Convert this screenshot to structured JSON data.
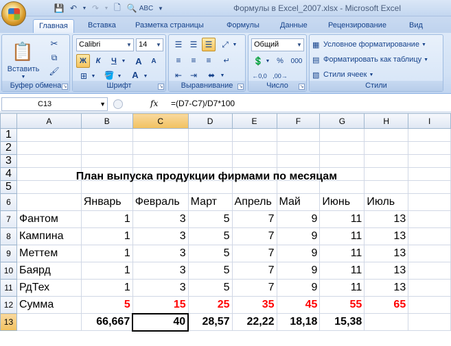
{
  "window": {
    "title": "Формулы в Excel_2007.xlsx - Microsoft Excel"
  },
  "tabs": [
    "Главная",
    "Вставка",
    "Разметка страницы",
    "Формулы",
    "Данные",
    "Рецензирование",
    "Вид"
  ],
  "ribbon": {
    "clipboard": {
      "label": "Буфер обмена",
      "paste": "Вставить"
    },
    "font": {
      "label": "Шрифт",
      "name": "Calibri",
      "size": "14",
      "bold": "Ж",
      "italic": "К",
      "underline": "Ч",
      "grow": "A",
      "shrink": "A"
    },
    "alignment": {
      "label": "Выравнивание"
    },
    "number": {
      "label": "Число",
      "format": "Общий",
      "percent": "%",
      "thousands": "000"
    },
    "styles": {
      "label": "Стили",
      "conditional": "Условное форматирование",
      "as_table": "Форматировать как таблицу",
      "cell_styles": "Стили ячеек"
    }
  },
  "formula_bar": {
    "name_box": "C13",
    "fx": "fx",
    "formula": "=(D7-C7)/D7*100"
  },
  "sheet": {
    "columns": [
      "A",
      "B",
      "C",
      "D",
      "E",
      "F",
      "G",
      "H",
      "I"
    ],
    "title": "План выпуска продукции фирмами по месяцам",
    "months": [
      "Январь",
      "Февраль",
      "Март",
      "Апрель",
      "Май",
      "Июнь",
      "Июль"
    ],
    "rows": [
      {
        "name": "Фантом",
        "values": [
          "1",
          "3",
          "5",
          "7",
          "9",
          "11",
          "13"
        ]
      },
      {
        "name": "Кампина",
        "values": [
          "1",
          "3",
          "5",
          "7",
          "9",
          "11",
          "13"
        ]
      },
      {
        "name": "Меттем",
        "values": [
          "1",
          "3",
          "5",
          "7",
          "9",
          "11",
          "13"
        ]
      },
      {
        "name": "Баярд",
        "values": [
          "1",
          "3",
          "5",
          "7",
          "9",
          "11",
          "13"
        ]
      },
      {
        "name": "РдТех",
        "values": [
          "1",
          "3",
          "5",
          "7",
          "9",
          "11",
          "13"
        ]
      }
    ],
    "sum": {
      "name": "Сумма",
      "values": [
        "5",
        "15",
        "25",
        "35",
        "45",
        "55",
        "65"
      ]
    },
    "percent_row": [
      "66,667",
      "40",
      "28,57",
      "22,22",
      "18,18",
      "15,38"
    ]
  },
  "colors": {
    "accent": "#15428b",
    "red": "#ff0000",
    "selected_header": "#f1c15f"
  }
}
